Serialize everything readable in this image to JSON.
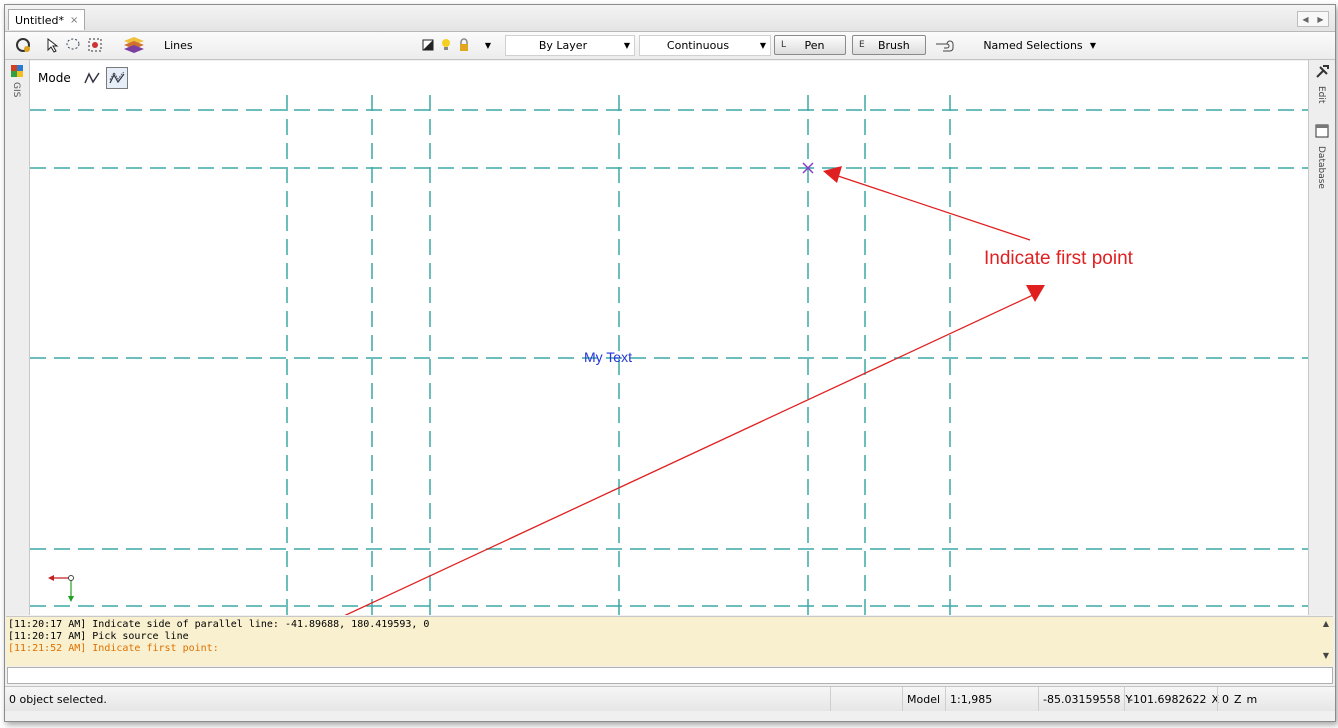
{
  "tabs": [
    {
      "label": "Untitled*",
      "close": "×"
    }
  ],
  "toolbar": {
    "layer_name": "Lines",
    "color": "By Layer",
    "linetype": "Continuous",
    "pen": {
      "key": "L",
      "label": "Pen"
    },
    "brush": {
      "key": "E",
      "label": "Brush"
    },
    "named_selections": "Named Selections"
  },
  "left_panel": {
    "label": "GIS"
  },
  "right_panel": {
    "edit_label": "Edit",
    "database_label": "Database"
  },
  "mode": {
    "label": "Mode"
  },
  "canvas": {
    "text_object": "My Text",
    "annotation": "Indicate first point",
    "colors": {
      "grid": "#3aa9a6",
      "arrow": "#e02020",
      "text": "#2436d8",
      "marker": "#8a3cc8"
    }
  },
  "log": [
    "[11:20:17 AM] Indicate side of parallel line: -41.89688, 180.419593, 0",
    "[11:20:17 AM] Pick source line",
    "[11:21:52 AM] Indicate first point:"
  ],
  "command_input": "",
  "status": {
    "selection": "0 object selected.",
    "space": "Model",
    "scale": "1:1,985",
    "y_value": "-85.03159558",
    "y_label": "Y",
    "x_value": "-101.6982622",
    "x_label": "X",
    "z_value": "0",
    "z_label": "Z",
    "unit": "m"
  }
}
